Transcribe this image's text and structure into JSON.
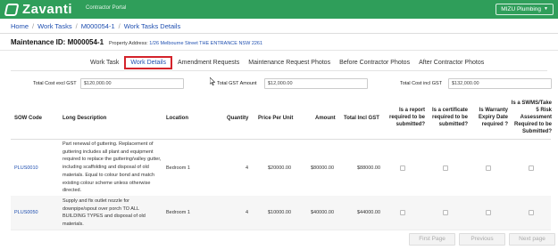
{
  "header": {
    "brand": "Zavanti",
    "portal": "Contractor Portal",
    "user": "MIZU Plumbing",
    "colors": {
      "bar": "#2f9e5a",
      "link": "#1f4fb0",
      "highlight": "#d4232b"
    }
  },
  "breadcrumb": {
    "items": [
      "Home",
      "Work Tasks",
      "M000054-1",
      "Work Tasks Details"
    ],
    "separator": "/"
  },
  "maintenance": {
    "title": "Maintenance ID: M000054-1",
    "address_label": "Property Address:",
    "address_value": "1/26 Melbourne Street THE ENTRANCE NSW 2261"
  },
  "tabs": [
    {
      "label": "Work Task"
    },
    {
      "label": "Work Details",
      "active": true
    },
    {
      "label": "Amendment Requests"
    },
    {
      "label": "Maintenance Request Photos"
    },
    {
      "label": "Before Contractor Photos"
    },
    {
      "label": "After Contractor Photos"
    }
  ],
  "totals": {
    "excl_label": "Total Cost excl GST",
    "excl_value": "$120,000.00",
    "gst_label": "Total GST Amount",
    "gst_value": "$12,000.00",
    "incl_label": "Total Cost incl GST",
    "incl_value": "$132,000.00"
  },
  "table": {
    "headers": {
      "sow": "SOW Code",
      "desc": "Long Description",
      "loc": "Location",
      "qty": "Quantity",
      "price": "Price Per Unit",
      "amount": "Amount",
      "incl": "Total Incl GST",
      "report": [
        "Is a report",
        "required to be",
        "submitted?"
      ],
      "cert": [
        "Is a certificate",
        "required to be",
        "submitted?"
      ],
      "warranty": [
        "Is Warranty",
        "Expiry Date",
        "required ?"
      ],
      "swms": [
        "Is a SWMS/Take",
        "5 Risk",
        "Assessment",
        "Required to be",
        "Submitted?"
      ]
    },
    "rows": [
      {
        "code": "PLUS0010",
        "desc": "Part renewal of guttering. Replacement of guttering includes all plant and equipment required to replace the guttering/valley gutter, including scaffolding and disposal of old materials. Equal to colour bond and match existing colour scheme unless otherwise directed.",
        "location": "Bedroom 1",
        "qty": "4",
        "price": "$20000.00",
        "amount": "$80000.00",
        "incl": "$88000.00"
      },
      {
        "code": "PLUS0050",
        "desc": "Supply and fix outlet nozzle for downpipe/spout over porch TO ALL BUILDING TYPES and disposal of old materials.",
        "location": "Bedroom 1",
        "qty": "4",
        "price": "$10000.00",
        "amount": "$40000.00",
        "incl": "$44000.00"
      }
    ]
  },
  "pager": {
    "first": "First Page",
    "prev": "Previous",
    "next": "Next page"
  }
}
